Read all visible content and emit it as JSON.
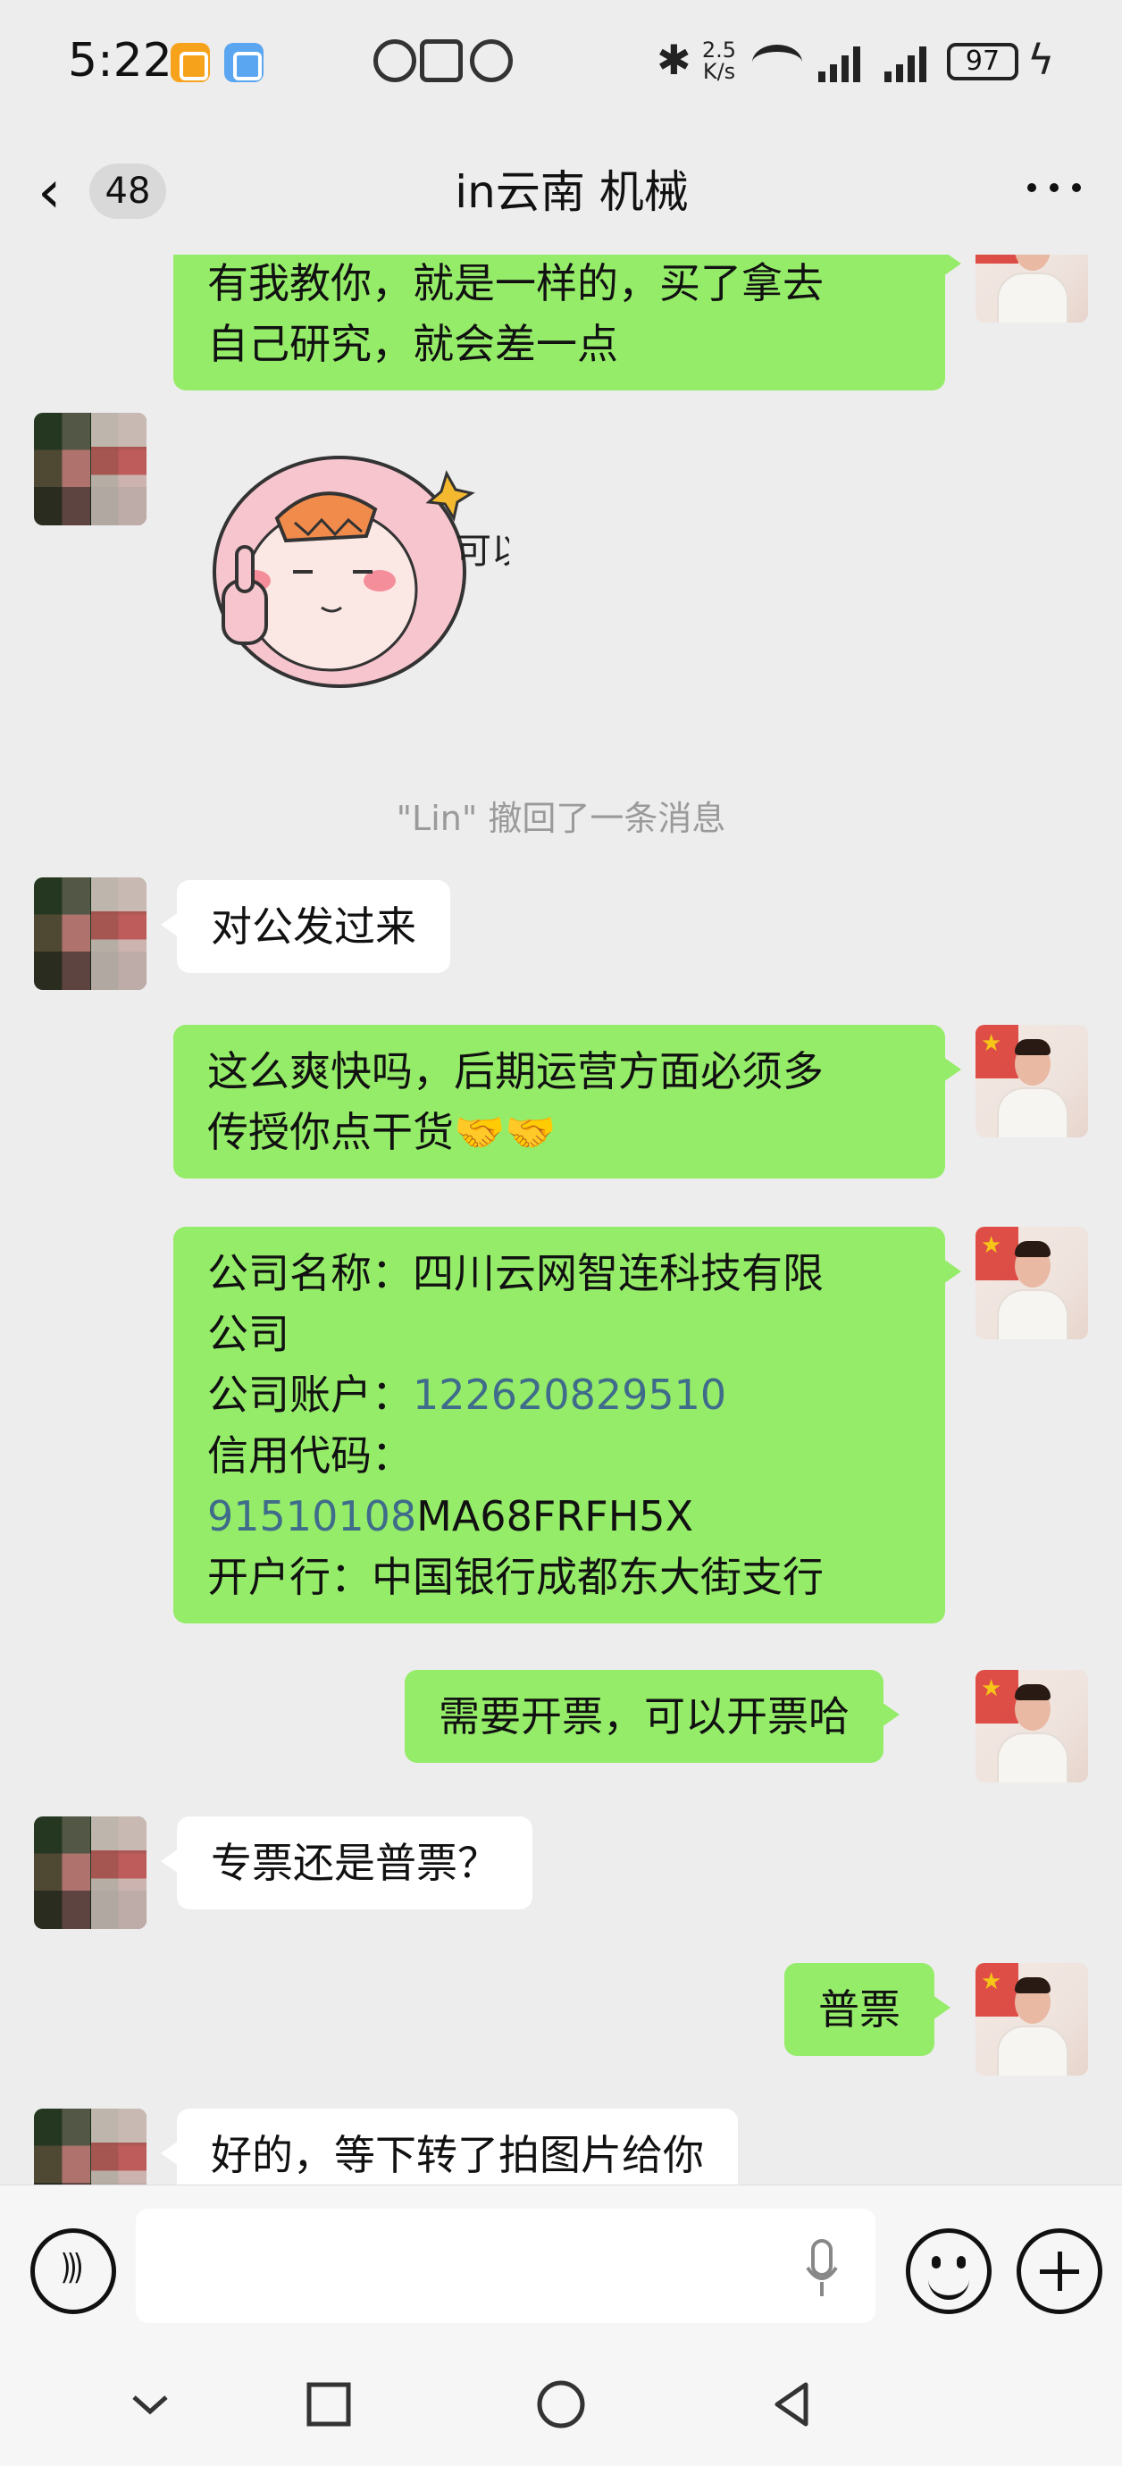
{
  "status_bar": {
    "time": "5:22",
    "net_speed": "2.5 K/s",
    "battery": "97"
  },
  "header": {
    "unread_count": "48",
    "title": "in云南  机械"
  },
  "messages": [
    {
      "side": "mine",
      "lines": [
        "有我教你，就是一样的，买了拿去",
        "自己研究，就会差一点"
      ]
    },
    {
      "side": "theirs",
      "type": "sticker",
      "sticker_text": "可以"
    },
    {
      "side": "system",
      "text": "\"Lin\" 撤回了一条消息"
    },
    {
      "side": "theirs",
      "text": "对公发过来"
    },
    {
      "side": "mine",
      "lines": [
        "这么爽快吗，后期运营方面必须多",
        "传授你点干货🤝🤝"
      ]
    },
    {
      "side": "mine",
      "company_label": "公司名称：",
      "company_name": "四川云网智连科技有限",
      "company_name_2": "公司",
      "account_label": "公司账户：",
      "account_number": "122620829510",
      "credit_label": "信用代码：",
      "credit_digits": "91510108",
      "credit_suffix": "MA68FRFH5X",
      "bank_label": "开户行：",
      "bank_name": "中国银行成都东大街支行"
    },
    {
      "side": "mine",
      "text": "需要开票，可以开票哈"
    },
    {
      "side": "theirs",
      "text": "专票还是普票？"
    },
    {
      "side": "mine",
      "text": "普票"
    },
    {
      "side": "theirs",
      "text": "好的，等下转了拍图片给你"
    }
  ],
  "input": {
    "placeholder": ""
  },
  "icons": {
    "back": "chevron-left-icon",
    "more": "more-dots-icon",
    "voice": "voice-icon",
    "mic": "microphone-icon",
    "emoji": "emoji-icon",
    "plus": "plus-icon"
  },
  "colors": {
    "my_bubble": "#95ec69",
    "their_bubble": "#ffffff",
    "background": "#ededed",
    "number_link": "#3f6c8a"
  }
}
